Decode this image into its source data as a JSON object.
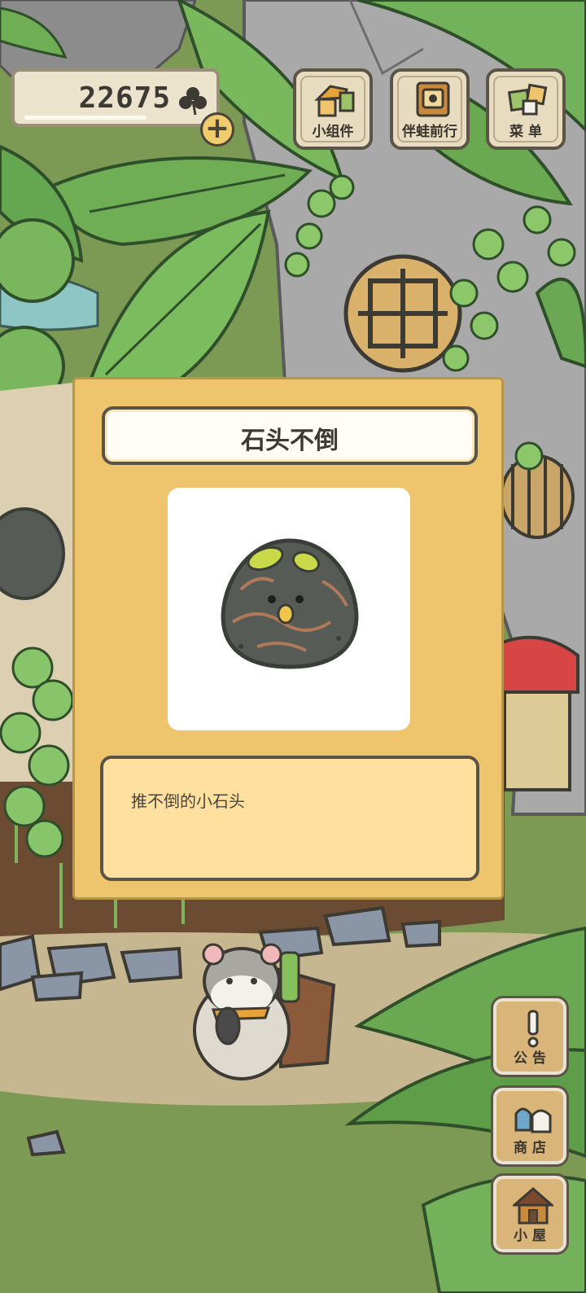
{
  "hud": {
    "clover_count": "22675",
    "clover_icon": "clover-icon",
    "add_icon": "plus-icon"
  },
  "top_buttons": [
    {
      "label": "小组件",
      "icon": "widget-icon"
    },
    {
      "label": "伴蛙前行",
      "icon": "journey-book-icon"
    },
    {
      "label": "菜 单",
      "icon": "menu-cards-icon"
    }
  ],
  "side_buttons": [
    {
      "label": "公 告",
      "icon": "exclamation-icon"
    },
    {
      "label": "商 店",
      "icon": "shop-bags-icon"
    },
    {
      "label": "小 屋",
      "icon": "house-icon"
    }
  ],
  "item_dialog": {
    "title": "石头不倒",
    "item_icon": "stone-tumbler-icon",
    "description": "推不倒的小石头"
  },
  "colors": {
    "dialog_bg": "#eec46c",
    "description_bg": "#ffe09e",
    "button_bg": "#e8dcc0",
    "side_button_bg": "#d9b57a"
  }
}
